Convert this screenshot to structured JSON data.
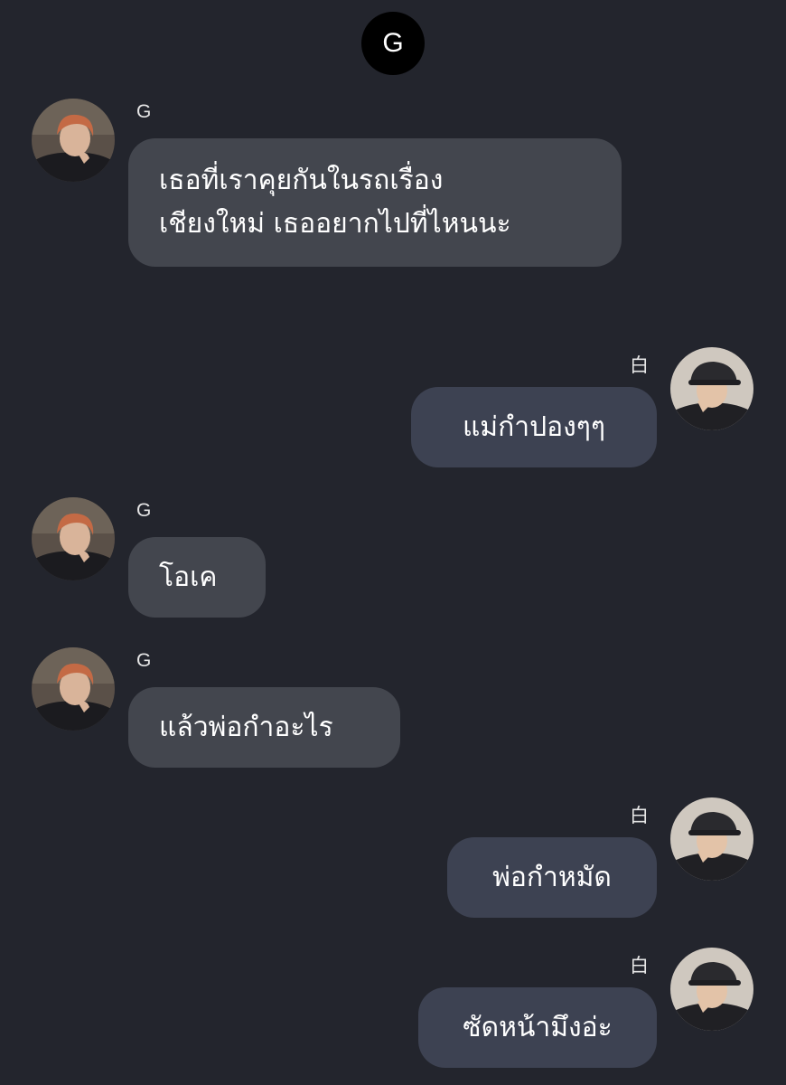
{
  "header": {
    "group_initial": "G"
  },
  "participants": {
    "other_name": "G",
    "self_name": "白"
  },
  "messages": [
    {
      "sender": "G",
      "direction": "incoming",
      "lines": [
        "เธอที่เราคุยกันในรถเรื่อง",
        "เชียงใหม่ เธออยากไปที่ไหนนะ"
      ]
    },
    {
      "sender": "白",
      "direction": "outgoing",
      "lines": [
        "แม่กำปองๆๆ"
      ]
    },
    {
      "sender": "G",
      "direction": "incoming",
      "lines": [
        "โอเค"
      ]
    },
    {
      "sender": "G",
      "direction": "incoming",
      "lines": [
        "แล้วพ่อกำอะไร"
      ]
    },
    {
      "sender": "白",
      "direction": "outgoing",
      "lines": [
        "พ่อกำหมัด"
      ]
    },
    {
      "sender": "白",
      "direction": "outgoing",
      "lines": [
        "ซัดหน้ามึงอ่ะ"
      ]
    }
  ],
  "colors": {
    "background": "#23252d",
    "incoming_bubble": "#43464e",
    "outgoing_bubble": "#3d4252",
    "top_avatar": "#000000"
  }
}
